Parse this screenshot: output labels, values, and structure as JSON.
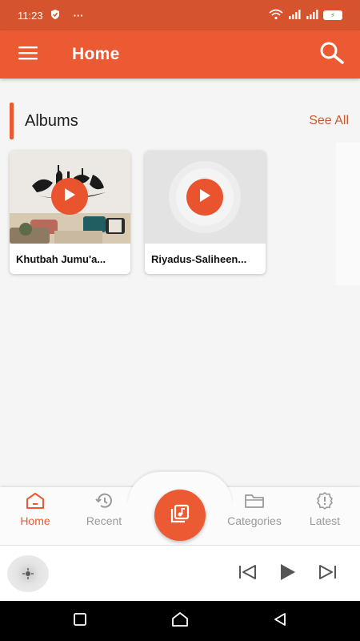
{
  "status_bar": {
    "time": "11:23",
    "dots": "···"
  },
  "app_bar": {
    "title": "Home",
    "menu_icon": "hamburger-menu-icon",
    "search_icon": "search-icon"
  },
  "albums_section": {
    "title": "Albums",
    "see_all": "See All"
  },
  "albums": [
    {
      "title": "Khutbah Jumu'a...",
      "thumbnail": "calligraphy-interior-photo"
    },
    {
      "title": "Riyadus-Saliheen...",
      "thumbnail": "placeholder-disc"
    }
  ],
  "bottom_nav": [
    {
      "label": "Home",
      "icon": "home-icon",
      "active": true
    },
    {
      "label": "Recent",
      "icon": "history-icon",
      "active": false
    },
    {
      "label": "Categories",
      "icon": "folder-icon",
      "active": false
    },
    {
      "label": "Latest",
      "icon": "badge-icon",
      "active": false
    }
  ],
  "fab": {
    "icon": "music-library-icon"
  },
  "player": {
    "controls": [
      "previous-icon",
      "play-icon",
      "next-icon"
    ]
  },
  "colors": {
    "primary": "#ec5a33",
    "status_bar": "#d5542e",
    "inactive": "#9a9a9a"
  }
}
